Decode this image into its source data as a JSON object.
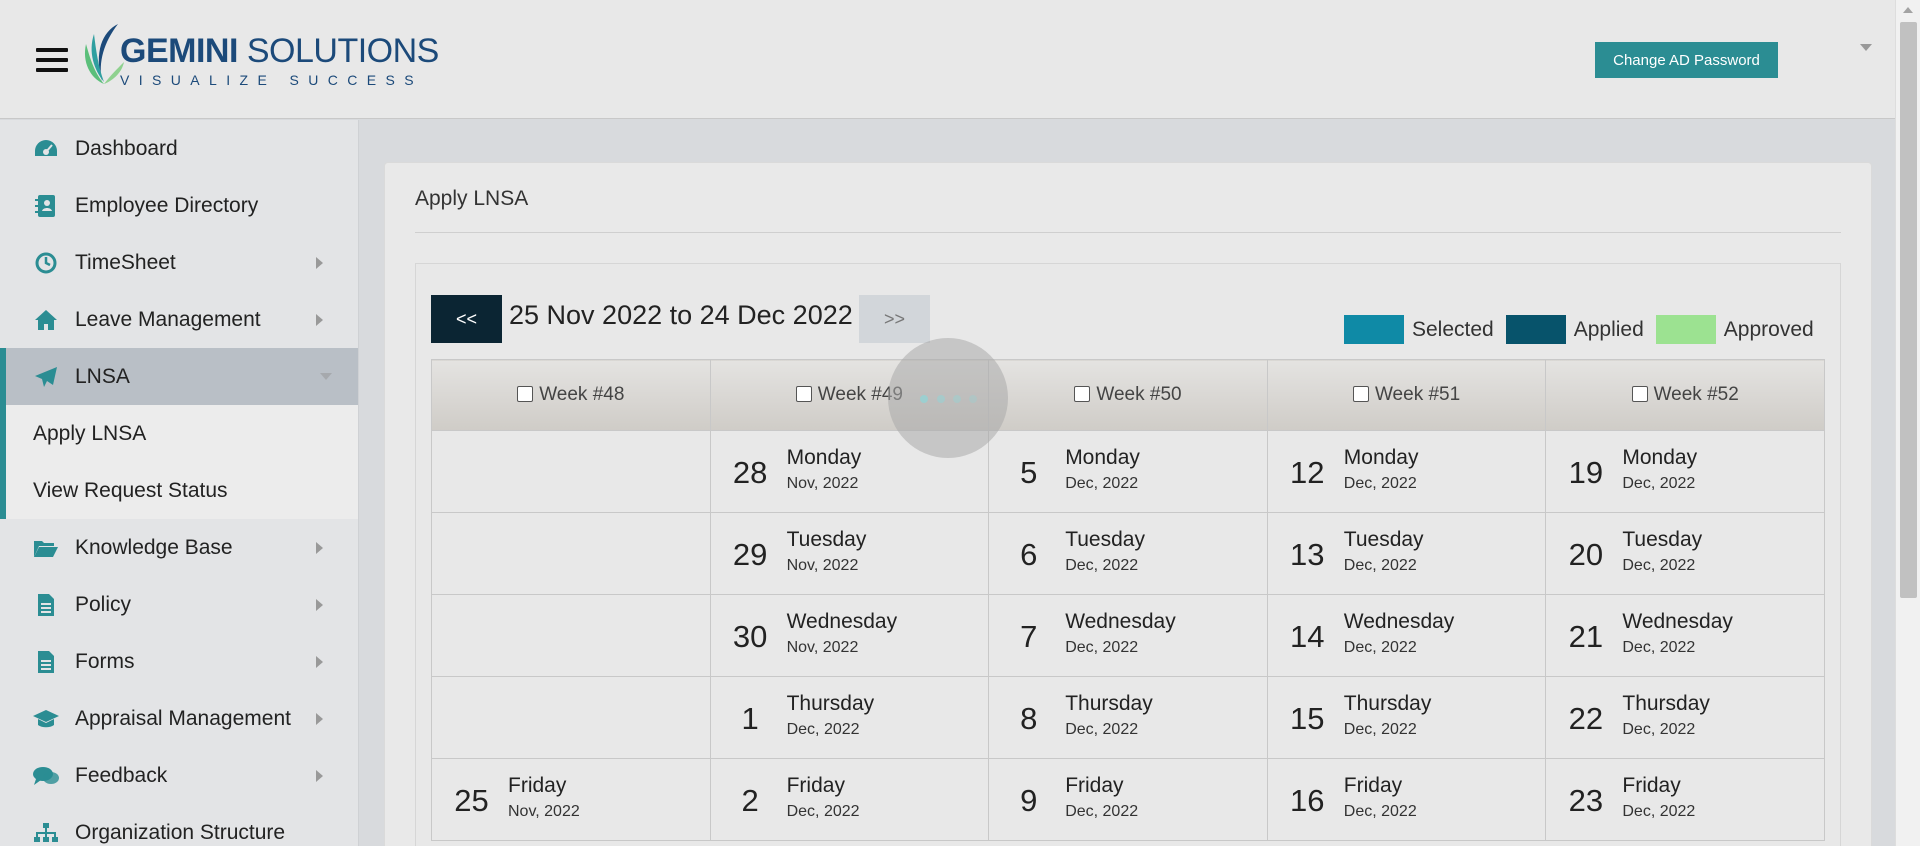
{
  "header": {
    "logo_brand": "GEMINI",
    "logo_brand2": " SOLUTIONS",
    "logo_tagline": "VISUALIZE SUCCESS",
    "change_password_label": "Change AD Password"
  },
  "sidebar": {
    "items": [
      {
        "label": "Dashboard",
        "icon": "dashboard-icon"
      },
      {
        "label": "Employee Directory",
        "icon": "directory-icon"
      },
      {
        "label": "TimeSheet",
        "icon": "clock-icon"
      },
      {
        "label": "Leave Management",
        "icon": "home-icon"
      },
      {
        "label": "LNSA",
        "icon": "paper-plane-icon"
      },
      {
        "label": "Knowledge Base",
        "icon": "folder-open-icon"
      },
      {
        "label": "Policy",
        "icon": "document-icon"
      },
      {
        "label": "Forms",
        "icon": "document-icon"
      },
      {
        "label": "Appraisal Management",
        "icon": "graduation-cap-icon"
      },
      {
        "label": "Feedback",
        "icon": "comments-icon"
      },
      {
        "label": "Organization Structure",
        "icon": "sitemap-icon"
      }
    ],
    "lnsa_sub": [
      "Apply LNSA",
      "View Request Status"
    ]
  },
  "main": {
    "title": "Apply LNSA",
    "prev_label": "<<",
    "next_label": ">>",
    "range": "25 Nov 2022 to 24 Dec 2022",
    "legend": [
      {
        "label": "Selected",
        "color": "#0f8aa6"
      },
      {
        "label": "Applied",
        "color": "#07536b"
      },
      {
        "label": "Approved",
        "color": "#9ce291"
      }
    ],
    "weeks": [
      "Week #48",
      "Week #49",
      "Week #50",
      "Week #51",
      "Week #52"
    ],
    "rows": [
      [
        null,
        {
          "num": "28",
          "wd": "Monday",
          "my": "Nov, 2022"
        },
        {
          "num": "5",
          "wd": "Monday",
          "my": "Dec, 2022"
        },
        {
          "num": "12",
          "wd": "Monday",
          "my": "Dec, 2022"
        },
        {
          "num": "19",
          "wd": "Monday",
          "my": "Dec, 2022"
        }
      ],
      [
        null,
        {
          "num": "29",
          "wd": "Tuesday",
          "my": "Nov, 2022"
        },
        {
          "num": "6",
          "wd": "Tuesday",
          "my": "Dec, 2022"
        },
        {
          "num": "13",
          "wd": "Tuesday",
          "my": "Dec, 2022"
        },
        {
          "num": "20",
          "wd": "Tuesday",
          "my": "Dec, 2022"
        }
      ],
      [
        null,
        {
          "num": "30",
          "wd": "Wednesday",
          "my": "Nov, 2022"
        },
        {
          "num": "7",
          "wd": "Wednesday",
          "my": "Dec, 2022"
        },
        {
          "num": "14",
          "wd": "Wednesday",
          "my": "Dec, 2022"
        },
        {
          "num": "21",
          "wd": "Wednesday",
          "my": "Dec, 2022"
        }
      ],
      [
        null,
        {
          "num": "1",
          "wd": "Thursday",
          "my": "Dec, 2022"
        },
        {
          "num": "8",
          "wd": "Thursday",
          "my": "Dec, 2022"
        },
        {
          "num": "15",
          "wd": "Thursday",
          "my": "Dec, 2022"
        },
        {
          "num": "22",
          "wd": "Thursday",
          "my": "Dec, 2022"
        }
      ],
      [
        {
          "num": "25",
          "wd": "Friday",
          "my": "Nov, 2022"
        },
        {
          "num": "2",
          "wd": "Friday",
          "my": "Dec, 2022"
        },
        {
          "num": "9",
          "wd": "Friday",
          "my": "Dec, 2022"
        },
        {
          "num": "16",
          "wd": "Friday",
          "my": "Dec, 2022"
        },
        {
          "num": "23",
          "wd": "Friday",
          "my": "Dec, 2022"
        }
      ]
    ]
  }
}
